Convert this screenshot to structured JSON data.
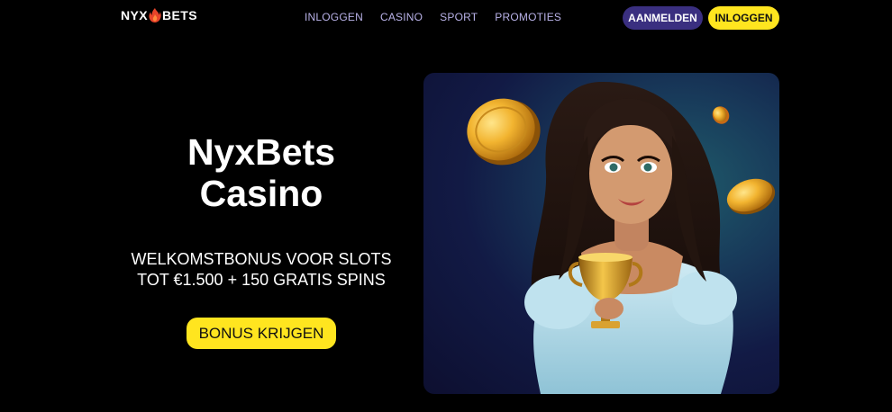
{
  "header": {
    "logo_left": "NYX",
    "logo_right": "BETS",
    "nav": [
      {
        "label": "INLOGGEN"
      },
      {
        "label": "CASINO"
      },
      {
        "label": "SPORT"
      },
      {
        "label": "PROMOTIES"
      }
    ],
    "register_label": "AANMELDEN",
    "login_label": "INLOGGEN"
  },
  "hero": {
    "title_line1": "NyxBets",
    "title_line2": "Casino",
    "subtitle_line1": "WELKOMSTBONUS VOOR SLOTS",
    "subtitle_line2": "TOT €1.500 + 150 GRATIS SPINS",
    "cta_label": "BONUS KRIJGEN"
  },
  "colors": {
    "background": "#000000",
    "accent_yellow": "#ffe51f",
    "register_purple": "#3a2f80",
    "nav_text": "#b9b2e8",
    "logo_flame": "#e8442a"
  },
  "icons": {
    "logo": "flame-icon"
  }
}
